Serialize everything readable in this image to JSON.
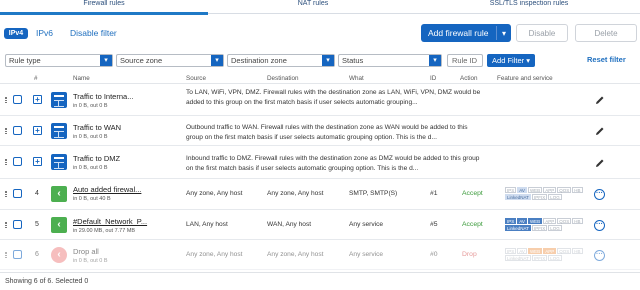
{
  "tabs": [
    {
      "label": "Firewall rules",
      "active": true
    },
    {
      "label": "NAT rules",
      "active": false
    },
    {
      "label": "SSL/TLS inspection rules",
      "active": false
    }
  ],
  "toolbar": {
    "ipv4": "IPv4",
    "ipv6": "IPv6",
    "disable_filter": "Disable filter",
    "add_rule": "Add firewall rule",
    "disable": "Disable",
    "delete": "Delete"
  },
  "filters": {
    "rule_type": "Rule type",
    "source_zone": "Source zone",
    "destination_zone": "Destination zone",
    "status": "Status",
    "rule_id_placeholder": "Rule ID",
    "add_filter": "Add Filter",
    "reset_filter": "Reset filter"
  },
  "columns": {
    "num": "#",
    "name": "Name",
    "source": "Source",
    "destination": "Destination",
    "what": "What",
    "id": "ID",
    "action": "Action",
    "feature": "Feature and service"
  },
  "rows": [
    {
      "name": "Traffic to Interna...",
      "stats": "in 0 B, out 0 B",
      "description": "To LAN, WiFi, VPN, DMZ. Firewall rules with the destination zone as LAN, WiFi, VPN, DMZ would be added to this group on the first match basis if user selects automatic grouping..."
    },
    {
      "name": "Traffic to WAN",
      "stats": "in 0 B, out 0 B",
      "description": "Outbound traffic to WAN. Firewall rules with the destination zone as WAN would be added to this group on the first match basis if user selects automatic grouping option. This is the d..."
    },
    {
      "name": "Traffic to DMZ",
      "stats": "in 0 B, out 0 B",
      "description": "Inbound traffic to DMZ. Firewall rules with the destination zone as DMZ would be added to this group on the first match basis if user selects automatic grouping option. This is the d..."
    },
    {
      "num": "4",
      "name": "Auto added firewal...",
      "stats": "in 0 B, out 40 B",
      "source": "Any zone, Any host",
      "destination": "Any zone, Any host",
      "what": "SMTP, SMTP(S)",
      "id": "#1",
      "action": "Accept"
    },
    {
      "num": "5",
      "name": "#Default_Network_P...",
      "stats": "in 29.00 MB, out 7.77 MB",
      "source": "LAN, Any host",
      "destination": "WAN, Any host",
      "what": "Any service",
      "id": "#5",
      "action": "Accept"
    },
    {
      "num": "6",
      "name": "Drop all",
      "stats": "in 0 B, out 0 B",
      "source": "Any zone, Any host",
      "destination": "Any zone, Any host",
      "what": "Any service",
      "id": "#0",
      "action": "Drop"
    }
  ],
  "badges": [
    "IPS",
    "AV",
    "WEB",
    "APP",
    "QOS",
    "HB",
    "LinkedNAT",
    "IPFIX",
    "LOG"
  ],
  "footer": "Showing 6 of 6. Selected 0",
  "colors": {
    "accent": "#1565c0",
    "accept": "#3a9a3a",
    "drop": "#d04545"
  }
}
